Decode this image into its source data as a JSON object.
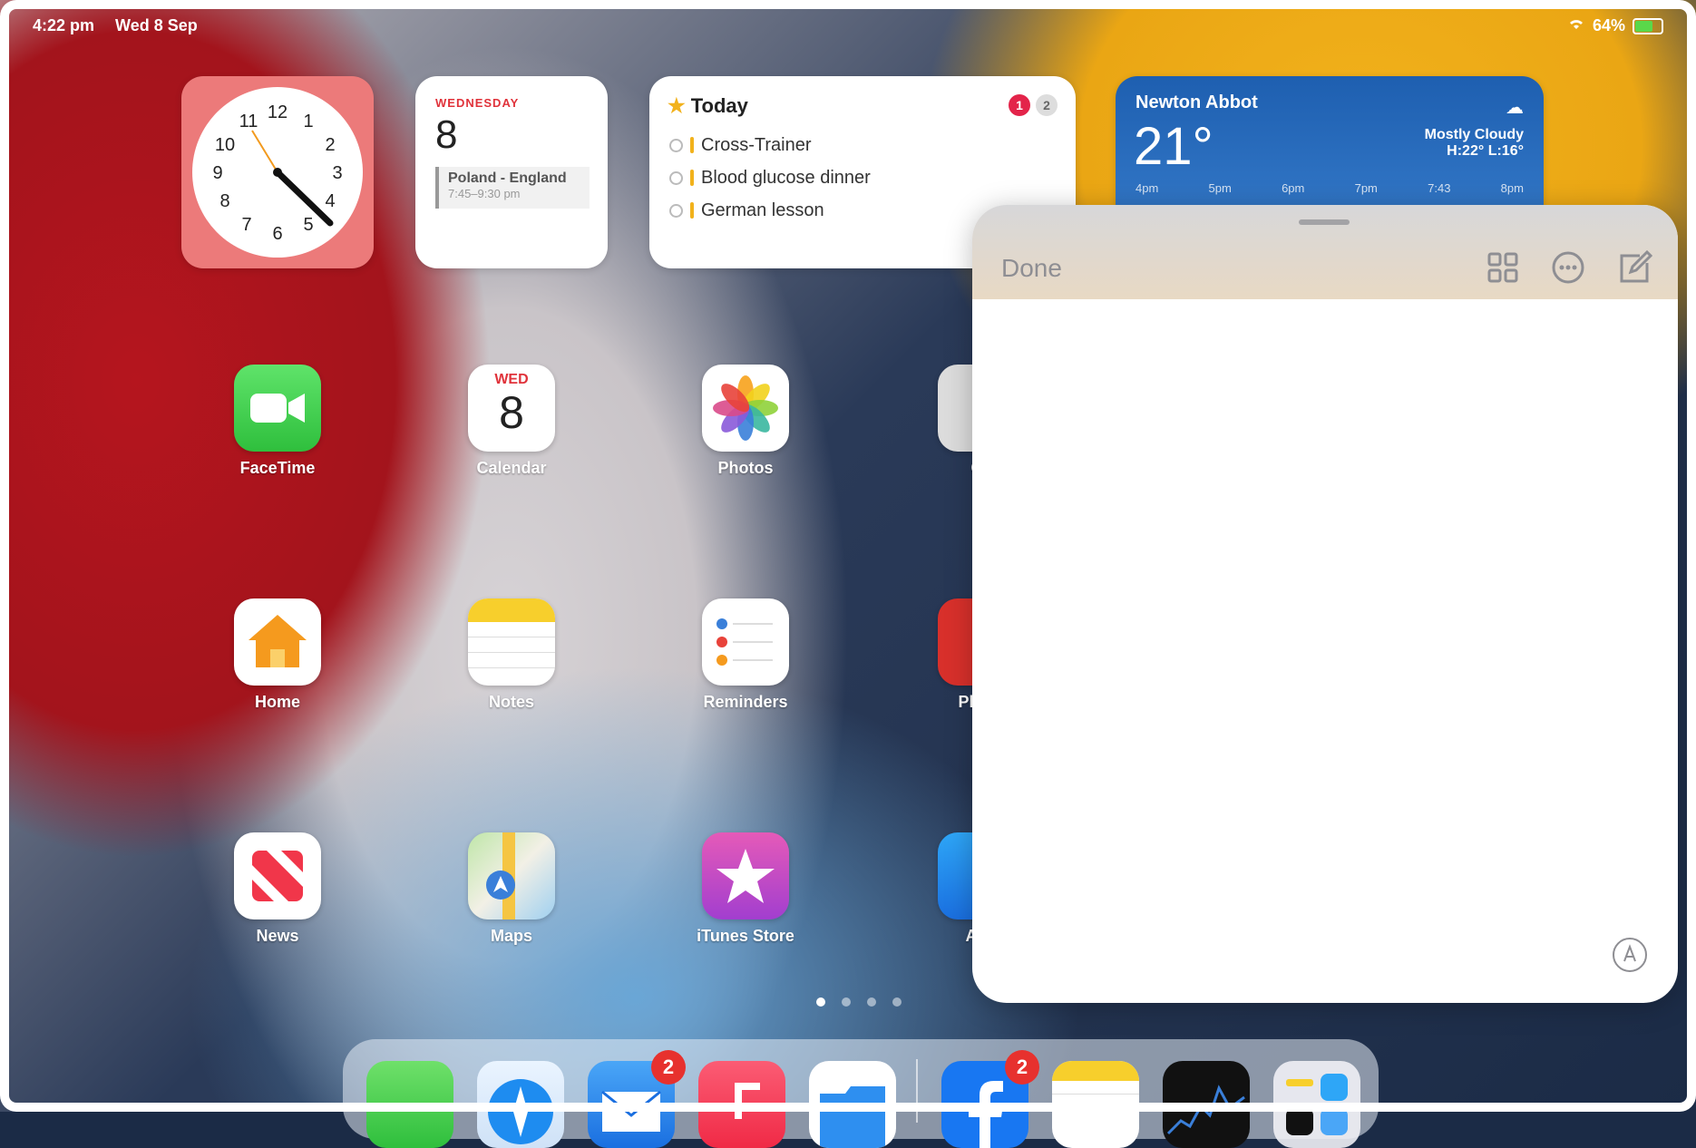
{
  "status": {
    "time": "4:22 pm",
    "date": "Wed 8 Sep",
    "battery": "64%"
  },
  "widgets": {
    "clock": {
      "hours": [
        "12",
        "1",
        "2",
        "3",
        "4",
        "5",
        "6",
        "7",
        "8",
        "9",
        "10",
        "11"
      ]
    },
    "calendar": {
      "day": "WEDNESDAY",
      "date": "8",
      "event_title": "Poland - England",
      "event_time": "7:45–9:30 pm"
    },
    "reminders": {
      "title": "Today",
      "badges": [
        "1",
        "2"
      ],
      "items": [
        "Cross-Trainer",
        "Blood glucose dinner",
        "German lesson"
      ]
    },
    "weather": {
      "city": "Newton Abbot",
      "temp": "21°",
      "condition": "Mostly Cloudy",
      "hilo": "H:22° L:16°",
      "hours": [
        "4pm",
        "5pm",
        "6pm",
        "7pm",
        "7:43",
        "8pm"
      ]
    }
  },
  "apps": [
    {
      "label": "FaceTime"
    },
    {
      "label": "Calendar",
      "icon_day": "WED",
      "icon_date": "8"
    },
    {
      "label": "Photos"
    },
    {
      "label": "Camera",
      "visible_label": "Ca"
    },
    {
      "label": "Home"
    },
    {
      "label": "Notes"
    },
    {
      "label": "Reminders"
    },
    {
      "label": "Photo Booth",
      "visible_label": "Photo"
    },
    {
      "label": "News"
    },
    {
      "label": "Maps"
    },
    {
      "label": "iTunes Store"
    },
    {
      "label": "App Store",
      "visible_label": "App"
    }
  ],
  "page_dots": {
    "count": 4,
    "active": 1
  },
  "dock": {
    "apps": [
      "Messages",
      "Safari",
      "Mail",
      "Music",
      "Files",
      "Facebook",
      "Notes",
      "Stocks",
      "App Library"
    ],
    "mail_badge": "2",
    "facebook_badge": "2"
  },
  "quick_note": {
    "done_label": "Done",
    "icons": [
      "grid-icon",
      "more-icon",
      "compose-icon",
      "markup-icon"
    ]
  },
  "colors": {
    "accent_red": "#e3244a",
    "weather_blue": "#1e5fb0"
  }
}
